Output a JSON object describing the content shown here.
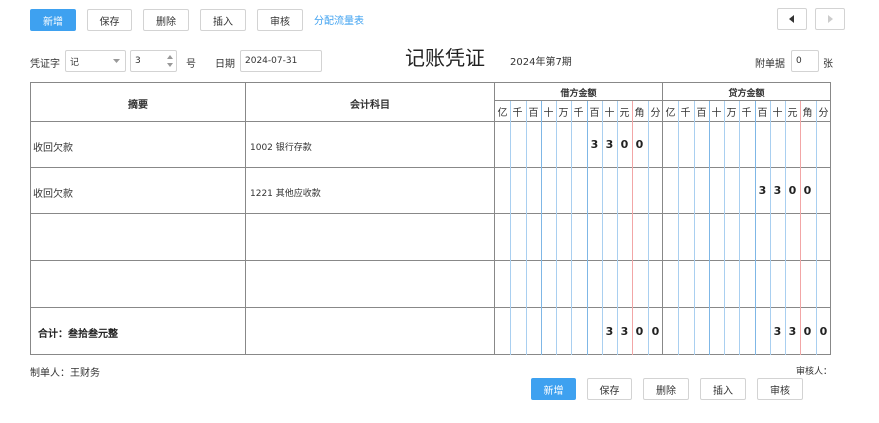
{
  "toolbar": {
    "add_label": "新增",
    "save_label": "保存",
    "delete_label": "删除",
    "insert_label": "插入",
    "audit_label": "审核",
    "cashflow_link": "分配流量表",
    "prev_icon": "triangle-left-icon",
    "next_icon": "triangle-right-icon"
  },
  "header": {
    "voucher_word_label": "凭证字",
    "voucher_word_value": "记",
    "voucher_number": "3",
    "number_suffix": "号",
    "date_label": "日期",
    "date_value": "2024-07-31",
    "title": "记账凭证",
    "period": "2024年第7期",
    "attachments_label": "附单据",
    "attachments_count": "0",
    "attachments_unit": "张"
  },
  "table": {
    "summary_header": "摘要",
    "account_header": "会计科目",
    "debit_header": "借方金额",
    "credit_header": "贷方金额",
    "digit_labels": [
      "亿",
      "千",
      "百",
      "十",
      "万",
      "千",
      "百",
      "十",
      "元",
      "角",
      "分"
    ],
    "rows": [
      {
        "summary": "收回欠款",
        "account": "1002 银行存款",
        "debit": [
          "",
          "",
          "",
          "",
          "",
          "",
          "3",
          "3",
          "0",
          "0",
          ""
        ],
        "credit": [
          "",
          "",
          "",
          "",
          "",
          "",
          "",
          "",
          "",
          "",
          ""
        ]
      },
      {
        "summary": "收回欠款",
        "account": "1221 其他应收款",
        "debit": [
          "",
          "",
          "",
          "",
          "",
          "",
          "",
          "",
          "",
          "",
          ""
        ],
        "credit": [
          "",
          "",
          "",
          "",
          "",
          "",
          "3",
          "3",
          "0",
          "0",
          ""
        ]
      },
      {
        "summary": "",
        "account": "",
        "debit": [],
        "credit": []
      },
      {
        "summary": "",
        "account": "",
        "debit": [],
        "credit": []
      }
    ],
    "total_label": "合计：叁拾叁元整",
    "total_debit": [
      "3",
      "3",
      "0",
      "0"
    ],
    "total_credit": [
      "3",
      "3",
      "0",
      "0"
    ]
  },
  "footer": {
    "maker": "制单人：王财务",
    "auditor": "审核人："
  },
  "colors": {
    "accent": "#3ea1f0",
    "digit_separator_blue": "#a9cff0",
    "digit_separator_red": "#f2a6a6"
  }
}
